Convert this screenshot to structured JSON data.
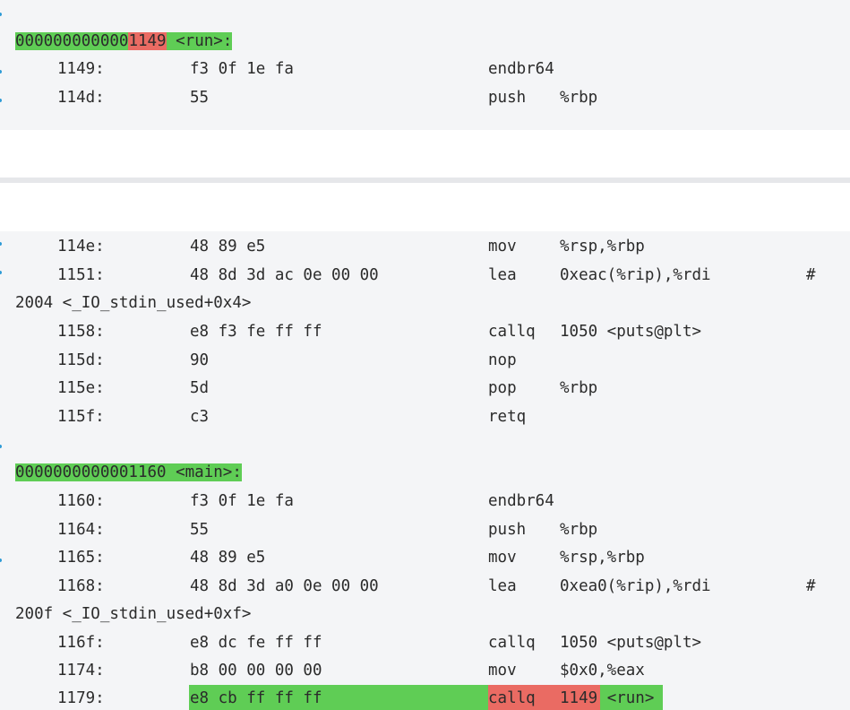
{
  "block1": {
    "label_prefix": "000000000000",
    "label_addr": "1149",
    "label_name": " <run>:",
    "rows": [
      {
        "addr": "1149:",
        "bytes": "f3 0f 1e fa",
        "mn": "endbr64",
        "op": ""
      },
      {
        "addr": "114d:",
        "bytes": "55",
        "mn": "push",
        "op": "%rbp"
      }
    ]
  },
  "block2": {
    "rows_run": [
      {
        "addr": "114e:",
        "bytes": "48 89 e5",
        "mn": "mov",
        "op": "%rsp,%rbp"
      },
      {
        "addr": "1151:",
        "bytes": "48 8d 3d ac 0e 00 00",
        "mn": "lea",
        "op": "0xeac(%rip),%rdi",
        "cmt": "#"
      }
    ],
    "wrap1": "2004 <_IO_stdin_used+0x4>",
    "rows_run2": [
      {
        "addr": "1158:",
        "bytes": "e8 f3 fe ff ff",
        "mn": "callq",
        "op": "1050 <puts@plt>"
      },
      {
        "addr": "115d:",
        "bytes": "90",
        "mn": "nop",
        "op": ""
      },
      {
        "addr": "115e:",
        "bytes": "5d",
        "mn": "pop",
        "op": "%rbp"
      },
      {
        "addr": "115f:",
        "bytes": "c3",
        "mn": "retq",
        "op": ""
      }
    ],
    "main_label": "0000000000001160 <main>:",
    "rows_main": [
      {
        "addr": "1160:",
        "bytes": "f3 0f 1e fa",
        "mn": "endbr64",
        "op": ""
      },
      {
        "addr": "1164:",
        "bytes": "55",
        "mn": "push",
        "op": "%rbp"
      },
      {
        "addr": "1165:",
        "bytes": "48 89 e5",
        "mn": "mov",
        "op": "%rsp,%rbp"
      },
      {
        "addr": "1168:",
        "bytes": "48 8d 3d a0 0e 00 00",
        "mn": "lea",
        "op": "0xea0(%rip),%rdi",
        "cmt": "#"
      }
    ],
    "wrap2": "200f <_IO_stdin_used+0xf>",
    "rows_main2": [
      {
        "addr": "116f:",
        "bytes": "e8 dc fe ff ff",
        "mn": "callq",
        "op": "1050 <puts@plt>"
      },
      {
        "addr": "1174:",
        "bytes": "b8 00 00 00 00",
        "mn": "mov",
        "op": "$0x0,%eax"
      }
    ],
    "last_row": {
      "addr": "1179:",
      "bytes": "e8 cb ff ff ff",
      "mn": "callq",
      "op_addr": "1149",
      "op_name": " <run>"
    }
  },
  "colors": {
    "highlight_green": "#5fcd55",
    "highlight_red": "#ea6b63",
    "block_bg": "#f4f5f7"
  }
}
